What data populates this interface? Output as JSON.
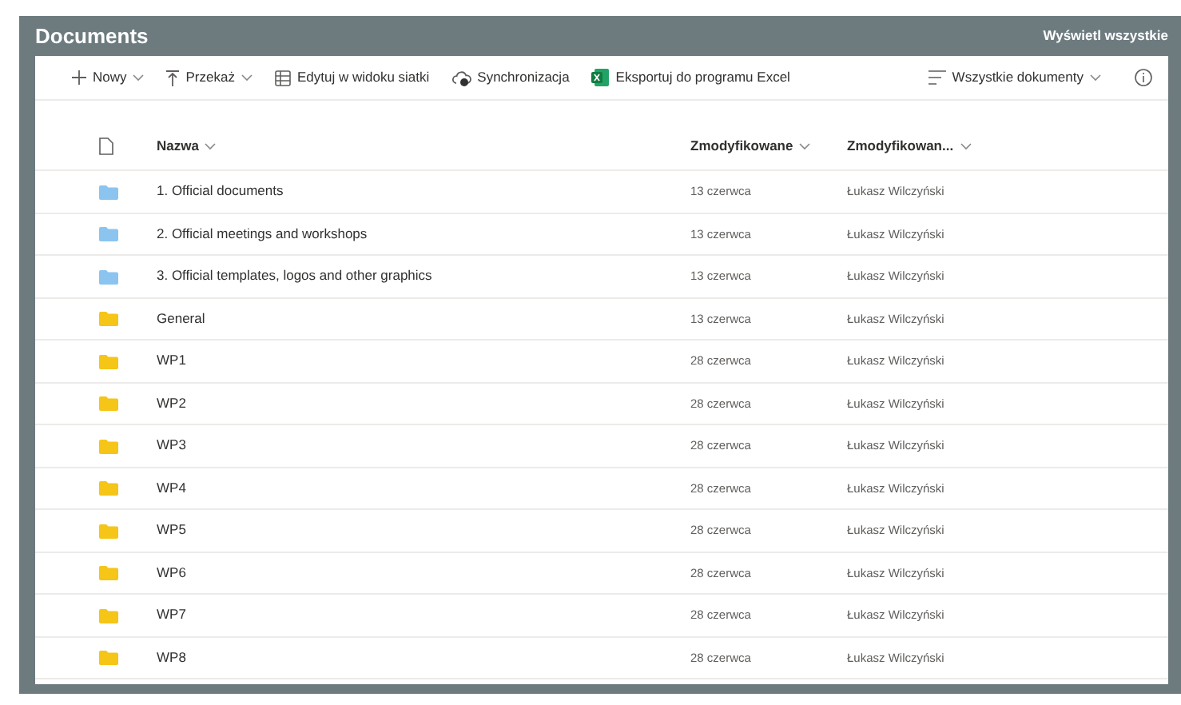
{
  "title": "Documents",
  "view_all": "Wyświetl wszystkie",
  "toolbar": [
    {
      "kind": "plus",
      "label": "Nowy",
      "dropdown": true
    },
    {
      "kind": "upload",
      "label": "Przekaż",
      "dropdown": true
    },
    {
      "kind": "grid",
      "label": "Edytuj w widoku siatki",
      "dropdown": false
    },
    {
      "kind": "sync",
      "label": "Synchronizacja",
      "dropdown": false
    },
    {
      "kind": "excel",
      "label": "Eksportuj do programu Excel",
      "dropdown": false
    }
  ],
  "view": {
    "label": "Wszystkie dokumenty"
  },
  "columns": [
    "Nazwa",
    "Zmodyfikowane",
    "Zmodyfikowan..."
  ],
  "rows": [
    {
      "name": "1. Official documents",
      "modified": "13 czerwca",
      "modified_by": "Łukasz Wilczyński",
      "color": "#8cc4f0"
    },
    {
      "name": "2. Official meetings and workshops",
      "modified": "13 czerwca",
      "modified_by": "Łukasz Wilczyński",
      "color": "#8cc4f0"
    },
    {
      "name": "3. Official templates, logos and other graphics",
      "modified": "13 czerwca",
      "modified_by": "Łukasz Wilczyński",
      "color": "#8cc4f0"
    },
    {
      "name": "General",
      "modified": "13 czerwca",
      "modified_by": "Łukasz Wilczyński",
      "color": "#f5c518"
    },
    {
      "name": "WP1",
      "modified": "28 czerwca",
      "modified_by": "Łukasz Wilczyński",
      "color": "#f5c518"
    },
    {
      "name": "WP2",
      "modified": "28 czerwca",
      "modified_by": "Łukasz Wilczyński",
      "color": "#f5c518"
    },
    {
      "name": "WP3",
      "modified": "28 czerwca",
      "modified_by": "Łukasz Wilczyński",
      "color": "#f5c518"
    },
    {
      "name": "WP4",
      "modified": "28 czerwca",
      "modified_by": "Łukasz Wilczyński",
      "color": "#f5c518"
    },
    {
      "name": "WP5",
      "modified": "28 czerwca",
      "modified_by": "Łukasz Wilczyński",
      "color": "#f5c518"
    },
    {
      "name": "WP6",
      "modified": "28 czerwca",
      "modified_by": "Łukasz Wilczyński",
      "color": "#f5c518"
    },
    {
      "name": "WP7",
      "modified": "28 czerwca",
      "modified_by": "Łukasz Wilczyński",
      "color": "#f5c518"
    },
    {
      "name": "WP8",
      "modified": "28 czerwca",
      "modified_by": "Łukasz Wilczyński",
      "color": "#f5c518"
    }
  ]
}
